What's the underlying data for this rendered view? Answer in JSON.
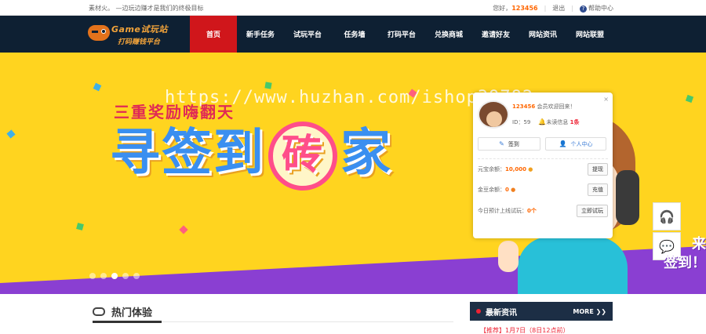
{
  "topbar": {
    "slogan": "素材火。 —边玩边赚才是我们的终极目标",
    "greeting": "您好，",
    "username": "123456",
    "logout": "退出",
    "help": "帮助中心"
  },
  "logo": {
    "line1": "Game试玩站",
    "line2": "打码赚钱平台"
  },
  "nav": {
    "items": [
      "首页",
      "新手任务",
      "试玩平台",
      "任务墙",
      "打码平台",
      "兑换商城",
      "邀请好友",
      "网站资讯",
      "网站联盟"
    ],
    "active_index": 0
  },
  "banner": {
    "headline_small": "三重奖励嗨翻天",
    "headline_big_a": "寻签到",
    "headline_big_brick": "砖",
    "headline_big_b": "家",
    "watermark": "https://www.huzhan.com/ishop39782",
    "slides": 5,
    "active_slide": 3,
    "colors": {
      "bg": "#ffd41f",
      "accent": "#3a8ff0",
      "pink": "#ff4e8a"
    }
  },
  "user_popup": {
    "close": "×",
    "username": "123456",
    "welcome": "会员欢迎回来！",
    "id_label": "ID：",
    "id_value": "59",
    "unread_label": "未读信息",
    "unread_count": "1条",
    "signin_button": "签到",
    "center_button": "个人中心",
    "yuanbao_label": "元宝余额：",
    "yuanbao_value": "10,000",
    "withdraw_button": "提现",
    "jindou_label": "金豆余额：",
    "jindou_value": "0",
    "recharge_button": "充值",
    "today_label": "今日预计上线试玩：",
    "today_value": "0个",
    "trial_button": "立即试玩"
  },
  "side": {
    "support_icon": "headset-icon",
    "qq_icon": "qq-icon",
    "checkin_text_1": "来",
    "checkin_text_2": "签到！"
  },
  "sections": {
    "hot_title": "热门体验",
    "news_title": "最新资讯",
    "news_more": "MORE",
    "news_first": "【推荐】1月7日（8日12点前）"
  }
}
